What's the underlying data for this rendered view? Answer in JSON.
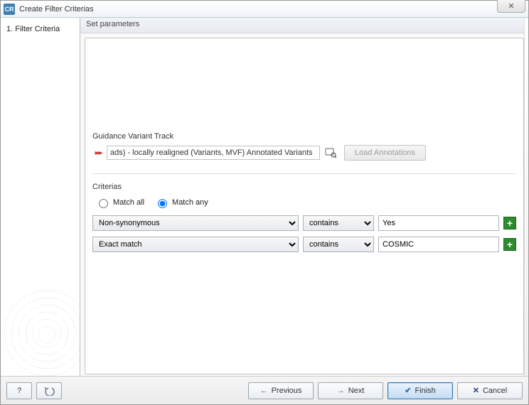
{
  "window": {
    "app_icon_text": "CR",
    "title": "Create Filter Criterias",
    "close_glyph": "✕"
  },
  "sidebar": {
    "items": [
      {
        "label": "1.  Filter Criteria"
      }
    ]
  },
  "main": {
    "header": "Set parameters",
    "guidance": {
      "section_label": "Guidance Variant Track",
      "track_value": "ads) - locally realigned (Variants, MVF) Annotated Variants",
      "load_label": "Load Annotations"
    },
    "criterias": {
      "section_label": "Criterias",
      "match_all_label": "Match all",
      "match_any_label": "Match any",
      "selected_mode": "any",
      "rows": [
        {
          "field": "Non-synonymous",
          "op": "contains",
          "value": "Yes"
        },
        {
          "field": "Exact match",
          "op": "contains",
          "value": "COSMIC"
        }
      ]
    }
  },
  "footer": {
    "help_label": "?",
    "previous_label": "Previous",
    "next_label": "Next",
    "finish_label": "Finish",
    "cancel_label": "Cancel"
  }
}
